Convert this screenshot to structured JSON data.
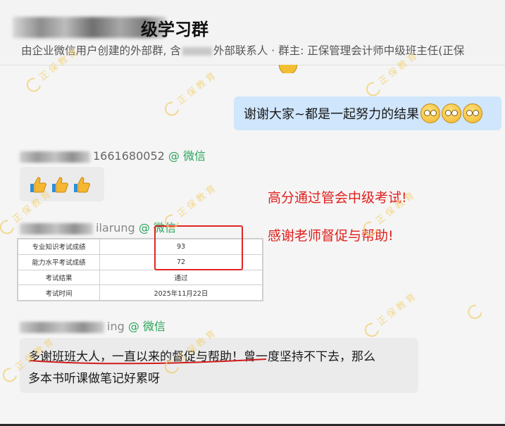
{
  "header": {
    "title_visible": "级学习群",
    "subtitle_prefix": "由企业微信用户创建的外部群, 含",
    "subtitle_suffix": "外部联系人 · 群主: 正保管理会计师中级班主任(正保"
  },
  "messages": [
    {
      "type": "self",
      "text": "谢谢大家~都是一起努力的结果",
      "emojis": [
        "grin-emoji",
        "grin-emoji",
        "grin-emoji"
      ]
    },
    {
      "sender_partial": "1661680052",
      "sender_tag": "@ 微信",
      "content": "thumbs-up x3"
    },
    {
      "sender_partial": "ilarung",
      "sender_tag": "@ 微信",
      "score_table": [
        [
          "专业知识考试成绩",
          "93"
        ],
        [
          "能力水平考试成绩",
          "72"
        ],
        [
          "考试结果",
          "通过"
        ],
        [
          "考试时间",
          "2025年11月22日"
        ]
      ]
    },
    {
      "sender_partial": "ing",
      "sender_tag": "@ 微信",
      "text_line1": "多谢班班大人，一直以来的督促与帮助！曾一度坚持不下去，那么",
      "text_line2": "多本书听课做笔记好累呀"
    }
  ],
  "annotations": {
    "line1": "高分通过管会中级考试!",
    "line2": "感谢老师督促与帮助!"
  },
  "watermark": {
    "text": "正 保 教 育",
    "color": "#f2cf6e"
  },
  "colors": {
    "self_bubble": "#cfe6fc",
    "other_bubble": "#ebebeb",
    "wechat_tag": "#2aa35b",
    "annotation": "#e0201c"
  }
}
